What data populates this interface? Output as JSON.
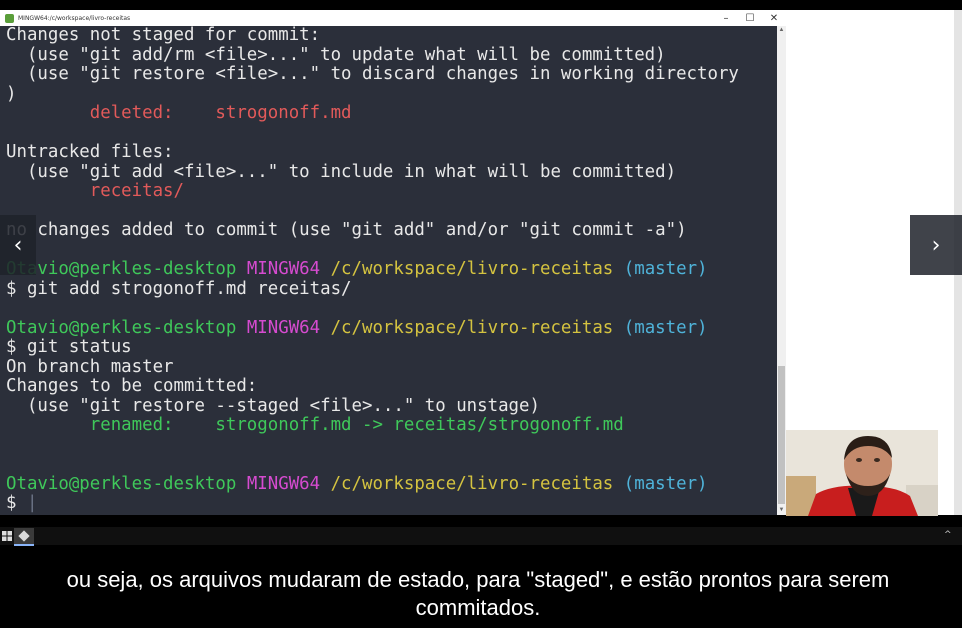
{
  "window": {
    "title": "MINGW64:/c/workspace/livro-receitas",
    "controls": {
      "minimize": "–",
      "maximize": "☐",
      "close": "✕"
    }
  },
  "terminal": {
    "lines": [
      [
        {
          "t": "Changes not staged for commit:",
          "c": ""
        }
      ],
      [
        {
          "t": "  (use \"git add/rm <file>...\" to update what will be committed)",
          "c": ""
        }
      ],
      [
        {
          "t": "  (use \"git restore <file>...\" to discard changes in working directory",
          "c": ""
        }
      ],
      [
        {
          "t": ")",
          "c": ""
        }
      ],
      [
        {
          "t": "        deleted:    strogonoff.md",
          "c": "red"
        }
      ],
      [
        {
          "t": "",
          "c": ""
        }
      ],
      [
        {
          "t": "Untracked files:",
          "c": ""
        }
      ],
      [
        {
          "t": "  (use \"git add <file>...\" to include in what will be committed)",
          "c": ""
        }
      ],
      [
        {
          "t": "        receitas/",
          "c": "red"
        }
      ],
      [
        {
          "t": "",
          "c": ""
        }
      ],
      [
        {
          "t": "no changes added to commit (use \"git add\" and/or \"git commit -a\")",
          "c": ""
        }
      ],
      [
        {
          "t": "",
          "c": ""
        }
      ],
      [
        {
          "t": "Otavio@perkles-desktop ",
          "c": "green"
        },
        {
          "t": "MINGW64 ",
          "c": "magenta"
        },
        {
          "t": "/c/workspace/livro-receitas ",
          "c": "yellow"
        },
        {
          "t": "(master)",
          "c": "cyan"
        }
      ],
      [
        {
          "t": "$ git add strogonoff.md receitas/",
          "c": ""
        }
      ],
      [
        {
          "t": "",
          "c": ""
        }
      ],
      [
        {
          "t": "Otavio@perkles-desktop ",
          "c": "green"
        },
        {
          "t": "MINGW64 ",
          "c": "magenta"
        },
        {
          "t": "/c/workspace/livro-receitas ",
          "c": "yellow"
        },
        {
          "t": "(master)",
          "c": "cyan"
        }
      ],
      [
        {
          "t": "$ git status",
          "c": ""
        }
      ],
      [
        {
          "t": "On branch master",
          "c": ""
        }
      ],
      [
        {
          "t": "Changes to be committed:",
          "c": ""
        }
      ],
      [
        {
          "t": "  (use \"git restore --staged <file>...\" to unstage)",
          "c": ""
        }
      ],
      [
        {
          "t": "        renamed:    strogonoff.md -> receitas/strogonoff.md",
          "c": "green"
        }
      ],
      [
        {
          "t": "",
          "c": ""
        }
      ],
      [
        {
          "t": "",
          "c": ""
        }
      ],
      [
        {
          "t": "Otavio@perkles-desktop ",
          "c": "green"
        },
        {
          "t": "MINGW64 ",
          "c": "magenta"
        },
        {
          "t": "/c/workspace/livro-receitas ",
          "c": "yellow"
        },
        {
          "t": "(master)",
          "c": "cyan"
        }
      ],
      [
        {
          "t": "$ ",
          "c": ""
        },
        {
          "t": "|",
          "c": "cursor"
        }
      ]
    ]
  },
  "player": {
    "prev_icon": "chevron-left-icon",
    "next_icon": "chevron-right-icon",
    "prev_glyph": "‹",
    "next_glyph": "›"
  },
  "taskbar": {
    "caret": "^"
  },
  "subtitle": "ou seja, os arquivos mudaram de estado, para \"staged\", e estão prontos para serem commitados.",
  "colors": {
    "terminal_bg": "#2b2f3a",
    "text": "#e8e8e8",
    "red": "#e25a5a",
    "green": "#3fc85a",
    "magenta": "#d64bd0",
    "yellow": "#d4c340",
    "cyan": "#4fb3d9"
  }
}
